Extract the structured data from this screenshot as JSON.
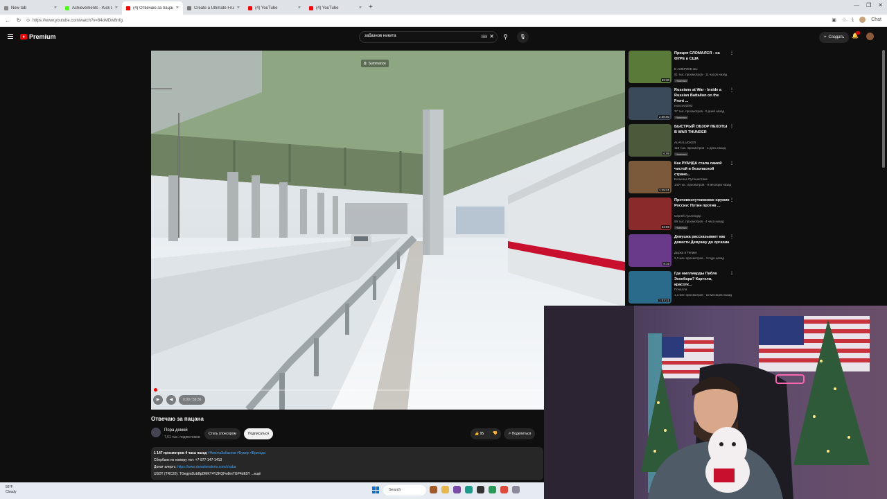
{
  "browser": {
    "tabs": [
      {
        "label": "New tab",
        "color": "#888888",
        "active": false
      },
      {
        "label": "Achievements - Kick Dashboard",
        "color": "#53fc18",
        "active": false
      },
      {
        "label": "(4) Отвечаю за пацана - YouTube",
        "color": "#ff0000",
        "active": true
      },
      {
        "label": "Create a Ultimate Fruit - Labeled F",
        "color": "#777777",
        "active": false
      },
      {
        "label": "(4) YouTube",
        "color": "#ff0000",
        "active": false
      },
      {
        "label": "(4) YouTube",
        "color": "#ff0000",
        "active": false
      }
    ],
    "new_tab": "+",
    "url": "https://www.youtube.com/watch?v=84oMDw8rrfg",
    "chat_label": "Chat"
  },
  "yt": {
    "logo_text": "Premium",
    "search_query": "забазнов никита",
    "create_label": "Создать",
    "video": {
      "summarize": "Summarize",
      "time": "0:00 / 59:36",
      "progress_fraction": 0.0,
      "title": "Отвечаю за пацана",
      "channel": "Пора домой",
      "subs": "7,61 тыс. подписчиков",
      "sponsor_label": "Стать спонсором",
      "subscribe_label": "Подписаться",
      "likes": "95",
      "share_label": "Поделиться",
      "desc_stats": "1 147 просмотров  4 часа назад",
      "desc_tags": "#НикитаЗабазнов #Бумер #Бригада",
      "desc_line2": "Сбербанк по номеру тел: +7-977-147-1413",
      "desc_line3_label": "Донат алертс:",
      "desc_line3_link": "https://www.donationalerts.com/r/zaba",
      "desc_line4": "USDT (TRC20): TGegjmDzbBpDMKT4YZKQFw8mTGP4dE5Y ...ещё"
    },
    "recs": [
      {
        "title": "Прицеп СЛОМАЛСЯ - на ФУРЕ в США",
        "channel": "В АМЕРИКЕ мы",
        "meta": "91 тыс. просмотров · 11 часов назад",
        "new": "Новинка",
        "dur": "52:30",
        "color": "#5a7a3a"
      },
      {
        "title": "Russians at War - Inside a Russian Battalion on the Front ...",
        "channel": "moscow2002",
        "meta": "37 тыс. просмотров · 5 дней назад",
        "new": "Новинка",
        "dur": "2:08:50",
        "color": "#3a4a5a"
      },
      {
        "title": "БЫСТРЫЙ ОБЗОР ПЕХОТЫ В WAR THUNDER",
        "channel": "ALAN LUCKER",
        "meta": "118 тыс. просмотров · 1 день назад",
        "new": "Новинка",
        "dur": "6:09",
        "color": "#4a5a3a"
      },
      {
        "title": "Как РУАНДА стала самой чистой и безопасной страно...",
        "channel": "Большое Путешествие",
        "meta": "140 тыс. просмотров · 9 месяцев назад",
        "new": "",
        "dur": "1:15:21",
        "color": "#7a5a3a"
      },
      {
        "title": "Противоспутниковое оружие России: Путин против ...",
        "channel": "Сергей Ауслендер",
        "meta": "59 тыс. просмотров · 4 часа назад",
        "new": "Новинка",
        "dur": "22:59",
        "color": "#8a2a2a"
      },
      {
        "title": "Девушка рассказывает как довести Девушку до оргазма",
        "channel": "Дырка в Телике",
        "meta": "2,3 млн просмотров · 3 года назад",
        "new": "",
        "dur": "9:16",
        "color": "#6a3a8a"
      },
      {
        "title": "Где миллиарды Пабло Эскобара? Картели, красотк...",
        "channel": "Почалла",
        "meta": "1,1 млн просмотров · 10 месяцев назад",
        "new": "",
        "dur": "1:03:21",
        "color": "#2a6a8a"
      }
    ]
  },
  "taskbar": {
    "temp": "56°F",
    "weather": "Cloudy",
    "search": "Search"
  }
}
